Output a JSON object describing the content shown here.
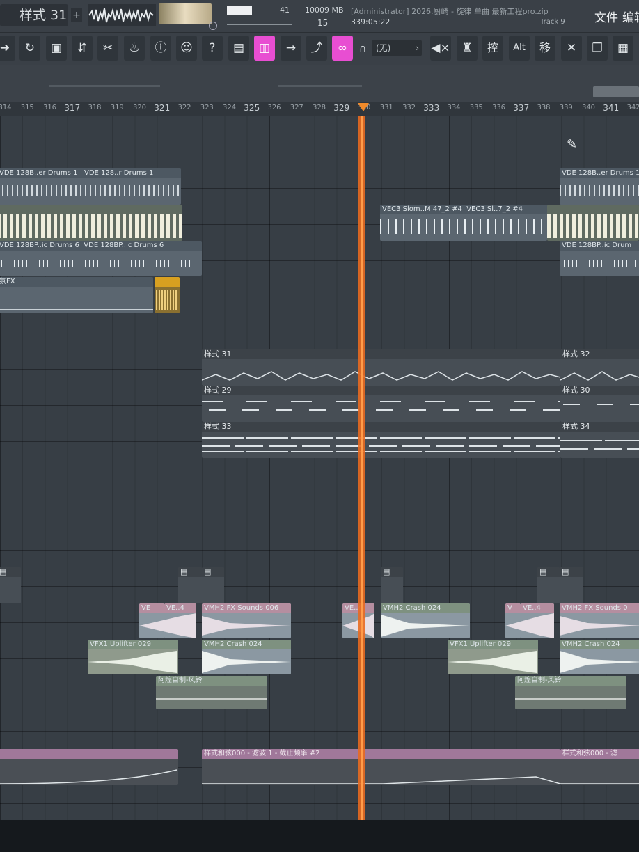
{
  "topbar": {
    "pattern_label": "样式 31",
    "plus": "+",
    "cpu_value": "41",
    "memory": "10009 MB",
    "polyphony": "15",
    "title": "[Administrator] 2026.厨崎 - 旋律 单曲 最新工程pro.zip",
    "time": "339:05:22",
    "track_hint": "Track 9",
    "menu_file": "文件",
    "menu_edit": "编辑"
  },
  "toolbar": {
    "snap_value": "(无)",
    "ctrl_label": "控",
    "alt_label": "Alt",
    "shift_label": "移"
  },
  "ruler": {
    "numbers": [
      "314",
      "315",
      "316",
      "317",
      "318",
      "319",
      "320",
      "321",
      "322",
      "323",
      "324",
      "325",
      "326",
      "327",
      "328",
      "329",
      "330",
      "331",
      "332",
      "333",
      "334",
      "335",
      "336",
      "337",
      "338",
      "339",
      "340",
      "341",
      "342"
    ]
  },
  "clips": {
    "drums1_a": "VDE 128B..er Drums 1",
    "drums1_b": "VDE 128..r Drums 1",
    "drums1_c": "VDE 128B..er Drums 1",
    "vec3_a": "VEC3 Slom..M 47_2 #4",
    "vec3_b": "VEC3 Sl..7_2 #4",
    "drums6_a": "VDE 128BP..ic Drums 6",
    "drums6_b": "VDE 128BP..ic Drums 6",
    "drums6_c": "VDE 128BP..ic Drum",
    "fx_label": "氛FX",
    "pat31": "样式 31",
    "pat32": "样式 32",
    "pat29": "样式 29",
    "pat30": "样式 30",
    "pat33": "样式 33",
    "pat34": "样式 34",
    "ve_a": "VE",
    "ve_b": "VE..4",
    "vmh2_fx_a": "VMH2 FX Sounds 006",
    "ve_c": "VE..4",
    "vmh2_crash_a": "VMH2 Crash 024",
    "v_d": "V",
    "ve_d": "VE..4",
    "vmh2_fx_b": "VMH2 FX Sounds 0",
    "vfx1_a": "VFX1 Uplifter 029",
    "vmh2_crash_b": "VMH2 Crash 024",
    "vfx1_b": "VFX1 Uplifter 029",
    "vmh2_crash_c": "VMH2 Crash 024",
    "wind_a": "阿煌自制-风铃",
    "wind_b": "阿煌自制-风铃",
    "auto_a": "样式和弦000 - 滤波 1 - 截止频率 #2",
    "auto_b": "样式和弦000 - 滤"
  }
}
